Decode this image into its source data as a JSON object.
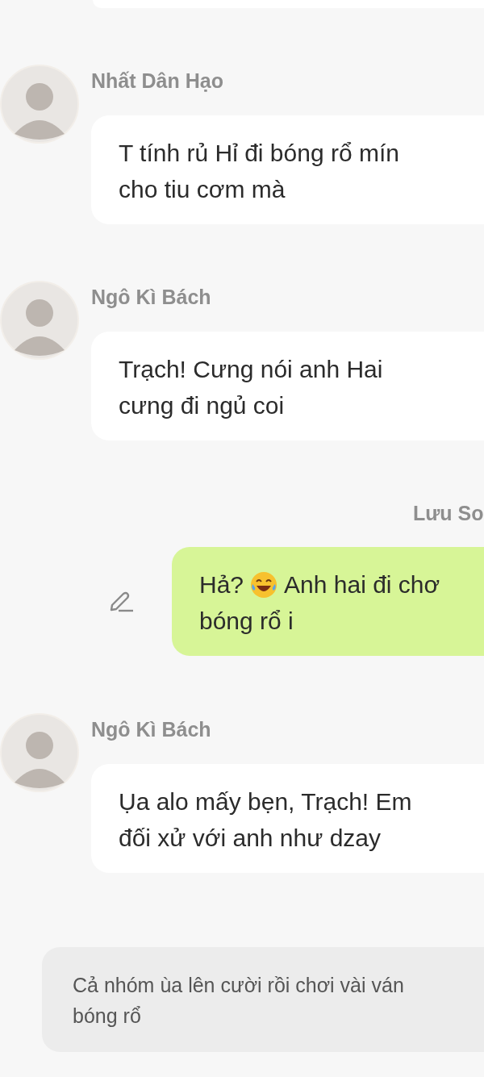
{
  "messages": [
    {
      "kind": "cut_bubble"
    },
    {
      "kind": "incoming",
      "sender": "Nhất Dân Hạo",
      "parts": [
        {
          "kind": "text",
          "text": "T tính rủ Hỉ đi bóng rổ mín\ncho tiu cơm mà"
        }
      ]
    },
    {
      "kind": "incoming",
      "sender": "Ngô Kì Bách",
      "parts": [
        {
          "kind": "text",
          "text": "Trạch! Cưng nói anh Hai\ncưng đi ngủ coi"
        }
      ]
    },
    {
      "kind": "outgoing",
      "sender": "Lưu So",
      "edited": true,
      "parts": [
        {
          "kind": "text",
          "text": "Hả?"
        },
        {
          "kind": "emoji"
        },
        {
          "kind": "text",
          "text": "Anh hai đi chơ"
        },
        {
          "kind": "break"
        },
        {
          "kind": "text",
          "text": "bóng rổ i"
        }
      ]
    },
    {
      "kind": "incoming",
      "sender": "Ngô Kì Bách",
      "parts": [
        {
          "kind": "text",
          "text": "Ụa alo mấy bẹn, Trạch! Em\nđối xử với anh như dzay"
        }
      ]
    },
    {
      "kind": "narration",
      "parts": [
        {
          "kind": "text",
          "text": "Cả nhóm ùa lên cười rồi chơi vài ván\nbóng rổ"
        }
      ]
    }
  ]
}
